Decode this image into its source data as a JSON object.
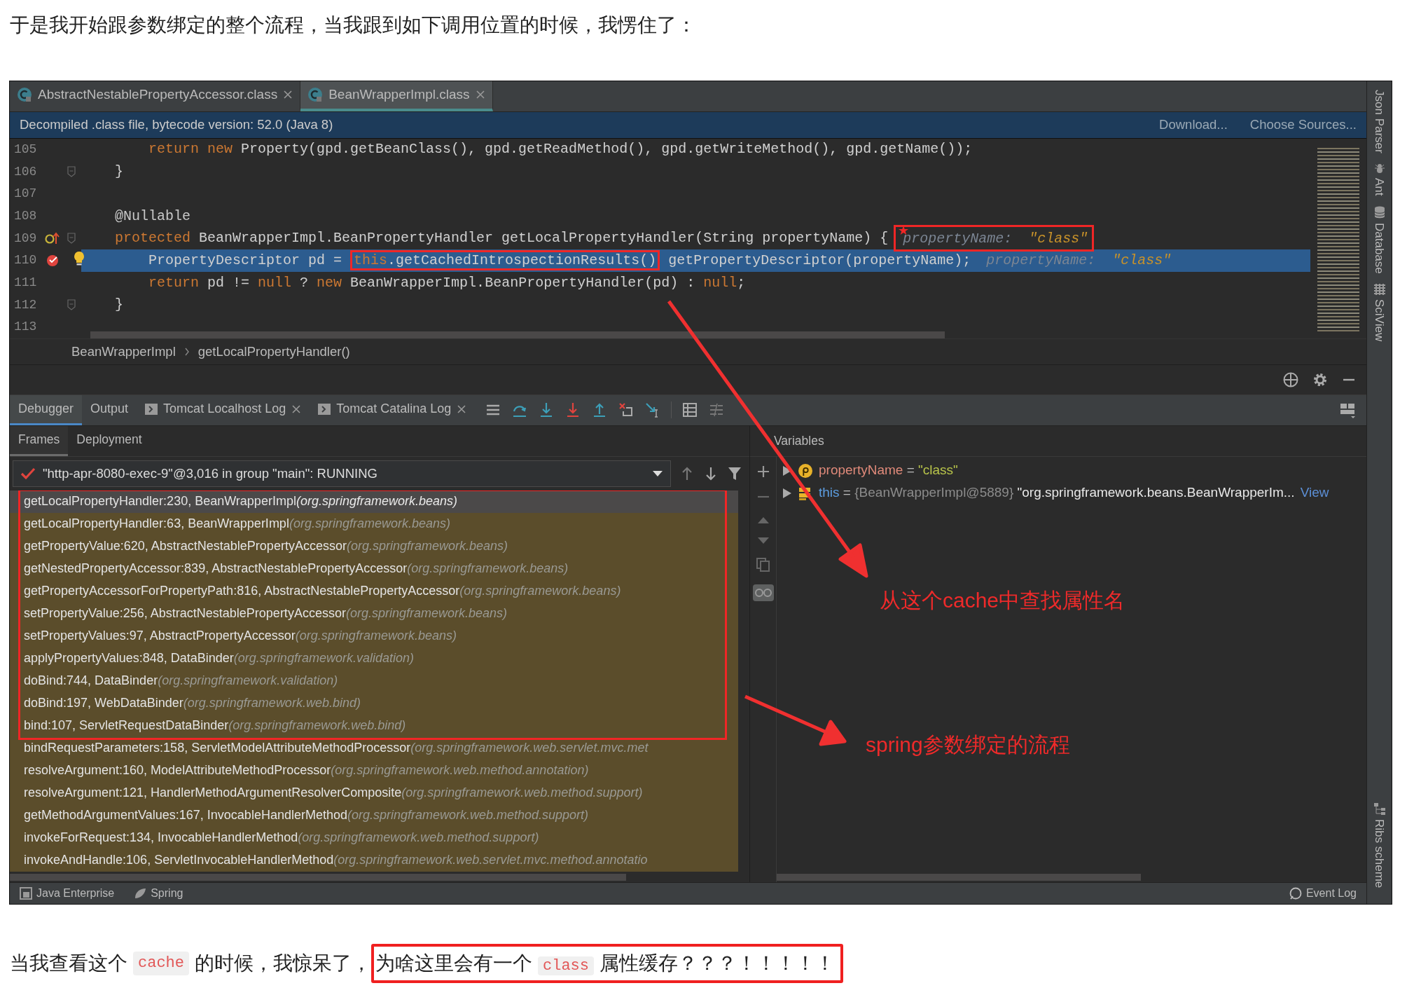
{
  "article": {
    "intro": "于是我开始跟参数绑定的整个流程，当我跟到如下调用位置的时候，我愣住了：",
    "outro": [
      {
        "kind": "text",
        "text": "当我查看这个"
      },
      {
        "kind": "code",
        "text": "cache"
      },
      {
        "kind": "text",
        "text": "的时候，我惊呆了，"
      },
      {
        "kind": "boxed",
        "parts": [
          {
            "kind": "text",
            "text": "为啥这里会有一个"
          },
          {
            "kind": "code",
            "text": "class"
          },
          {
            "kind": "text",
            "text": "属性缓存？？？！！！！！"
          }
        ]
      }
    ]
  },
  "ide": {
    "editor_tabs": [
      {
        "label": "AbstractNestablePropertyAccessor.class",
        "selected": false
      },
      {
        "label": "BeanWrapperImpl.class",
        "selected": true
      }
    ],
    "notice": {
      "text": "Decompiled .class file, bytecode version: 52.0 (Java 8)",
      "links": [
        "Download...",
        "Choose Sources..."
      ]
    },
    "code_lines": [
      {
        "number": "105",
        "kind": "plain",
        "current": false,
        "fold": false,
        "tokens": [
          {
            "kind": "keyword",
            "text": "        return new "
          },
          {
            "kind": "plain",
            "text": "Property(gpd.getBeanClass(), gpd.getReadMethod(), gpd.getWriteMethod(), gpd.getName());"
          }
        ]
      },
      {
        "number": "106",
        "kind": "plain",
        "current": false,
        "fold": true,
        "tokens": [
          {
            "kind": "plain",
            "text": "    }"
          }
        ]
      },
      {
        "number": "107",
        "kind": "plain",
        "current": false,
        "fold": false
      },
      {
        "number": "108",
        "kind": "plain",
        "current": false,
        "fold": false,
        "tokens": [
          {
            "kind": "annotation",
            "text": "    @Nullable"
          }
        ]
      },
      {
        "number": "109",
        "kind": "implements",
        "current": false,
        "fold": true,
        "tokens": [
          {
            "kind": "keyword",
            "text": "    protected "
          },
          {
            "kind": "plain",
            "text": "BeanWrapperImpl.BeanPropertyHandler getLocalPropertyHandler(String propertyName) {"
          }
        ],
        "hint": {
          "name": "propertyName:",
          "value": "\"class\"",
          "boxed": true
        }
      },
      {
        "number": "110",
        "kind": "breakpoint",
        "current": true,
        "fold": false,
        "tokens": [
          {
            "kind": "plain",
            "text": "        PropertyDescriptor pd = "
          },
          {
            "kind": "boxed",
            "tokens": [
              {
                "kind": "keyword",
                "text": "this"
              },
              {
                "kind": "plain",
                "text": ".getCachedIntrospectionResults()"
              }
            ]
          },
          {
            "kind": "plain",
            "text": " getPropertyDescriptor(propertyName);"
          }
        ],
        "hint": {
          "name": "propertyName:",
          "value": "\"class\"",
          "boxed": false
        }
      },
      {
        "number": "111",
        "kind": "plain",
        "current": false,
        "fold": false,
        "tokens": [
          {
            "kind": "keyword",
            "text": "        return "
          },
          {
            "kind": "plain",
            "text": "pd != "
          },
          {
            "kind": "keyword",
            "text": "null"
          },
          {
            "kind": "plain",
            "text": " ? "
          },
          {
            "kind": "keyword",
            "text": "new "
          },
          {
            "kind": "plain",
            "text": "BeanWrapperImpl.BeanPropertyHandler(pd) : "
          },
          {
            "kind": "keyword",
            "text": "null"
          },
          {
            "kind": "plain",
            "text": ";"
          }
        ]
      },
      {
        "number": "112",
        "kind": "plain",
        "current": false,
        "fold": true,
        "tokens": [
          {
            "kind": "plain",
            "text": "    }"
          }
        ]
      },
      {
        "number": "113",
        "kind": "plain",
        "current": false,
        "fold": false
      }
    ],
    "breadcrumb": [
      "BeanWrapperImpl",
      "getLocalPropertyHandler()"
    ],
    "tool_tabs": [
      {
        "label": "Debugger",
        "selected": true,
        "closable": false
      },
      {
        "label": "Output",
        "selected": false,
        "closable": false
      },
      {
        "label": "Tomcat Localhost Log",
        "selected": false,
        "closable": true
      },
      {
        "label": "Tomcat Catalina Log",
        "selected": false,
        "closable": true
      }
    ],
    "frame_tabs": [
      {
        "label": "Frames",
        "selected": true
      },
      {
        "label": "Deployment",
        "selected": false
      }
    ],
    "thread": "\"http-apr-8080-exec-9\"@3,016 in group \"main\": RUNNING",
    "frames": [
      {
        "method": "getLocalPropertyHandler:230, BeanWrapperImpl",
        "package": "(org.springframework.beans)",
        "selected": true,
        "annotated": true
      },
      {
        "method": "getLocalPropertyHandler:63, BeanWrapperImpl",
        "package": "(org.springframework.beans)",
        "selected": false,
        "annotated": true
      },
      {
        "method": "getPropertyValue:620, AbstractNestablePropertyAccessor",
        "package": "(org.springframework.beans)",
        "selected": false,
        "annotated": true
      },
      {
        "method": "getNestedPropertyAccessor:839, AbstractNestablePropertyAccessor",
        "package": "(org.springframework.beans)",
        "selected": false,
        "annotated": true
      },
      {
        "method": "getPropertyAccessorForPropertyPath:816, AbstractNestablePropertyAccessor",
        "package": "(org.springframework.beans)",
        "selected": false,
        "annotated": true
      },
      {
        "method": "setPropertyValue:256, AbstractNestablePropertyAccessor",
        "package": "(org.springframework.beans)",
        "selected": false,
        "annotated": true
      },
      {
        "method": "setPropertyValues:97, AbstractPropertyAccessor",
        "package": "(org.springframework.beans)",
        "selected": false,
        "annotated": true
      },
      {
        "method": "applyPropertyValues:848, DataBinder",
        "package": "(org.springframework.validation)",
        "selected": false,
        "annotated": true
      },
      {
        "method": "doBind:744, DataBinder",
        "package": "(org.springframework.validation)",
        "selected": false,
        "annotated": true
      },
      {
        "method": "doBind:197, WebDataBinder",
        "package": "(org.springframework.web.bind)",
        "selected": false,
        "annotated": true
      },
      {
        "method": "bind:107, ServletRequestDataBinder",
        "package": "(org.springframework.web.bind)",
        "selected": false,
        "annotated": true
      },
      {
        "method": "bindRequestParameters:158, ServletModelAttributeMethodProcessor",
        "package": "(org.springframework.web.servlet.mvc.met",
        "selected": false,
        "annotated": false
      },
      {
        "method": "resolveArgument:160, ModelAttributeMethodProcessor",
        "package": "(org.springframework.web.method.annotation)",
        "selected": false,
        "annotated": false
      },
      {
        "method": "resolveArgument:121, HandlerMethodArgumentResolverComposite",
        "package": "(org.springframework.web.method.support)",
        "selected": false,
        "annotated": false
      },
      {
        "method": "getMethodArgumentValues:167, InvocableHandlerMethod",
        "package": "(org.springframework.web.method.support)",
        "selected": false,
        "annotated": false
      },
      {
        "method": "invokeForRequest:134, InvocableHandlerMethod",
        "package": "(org.springframework.web.method.support)",
        "selected": false,
        "annotated": false
      },
      {
        "method": "invokeAndHandle:106, ServletInvocableHandlerMethod",
        "package": "(org.springframework.web.servlet.mvc.method.annotatio",
        "selected": false,
        "annotated": false
      }
    ],
    "variables_title": "Variables",
    "variables": [
      {
        "kind": "parameter",
        "name": "propertyName",
        "separator": "=",
        "value": "\"class\""
      },
      {
        "kind": "field",
        "name": "this",
        "separator": "=",
        "type": "{BeanWrapperImpl@5889}",
        "value": "\"org.springframework.beans.BeanWrapperIm...",
        "link": "View"
      }
    ],
    "side_tools_top": [
      {
        "kind": "text",
        "label": "Json Parser"
      },
      {
        "kind": "ant",
        "label": "Ant"
      },
      {
        "kind": "database",
        "label": "Database"
      },
      {
        "kind": "grid",
        "label": "SciView"
      }
    ],
    "side_tools_bottom": [
      {
        "kind": "scheme",
        "label": "Ribs scheme"
      }
    ],
    "status_left": [
      "Java Enterprise",
      "Spring"
    ],
    "status_right": "Event Log",
    "annotations": [
      "从这个cache中查找属性名",
      "spring参数绑定的流程"
    ]
  }
}
